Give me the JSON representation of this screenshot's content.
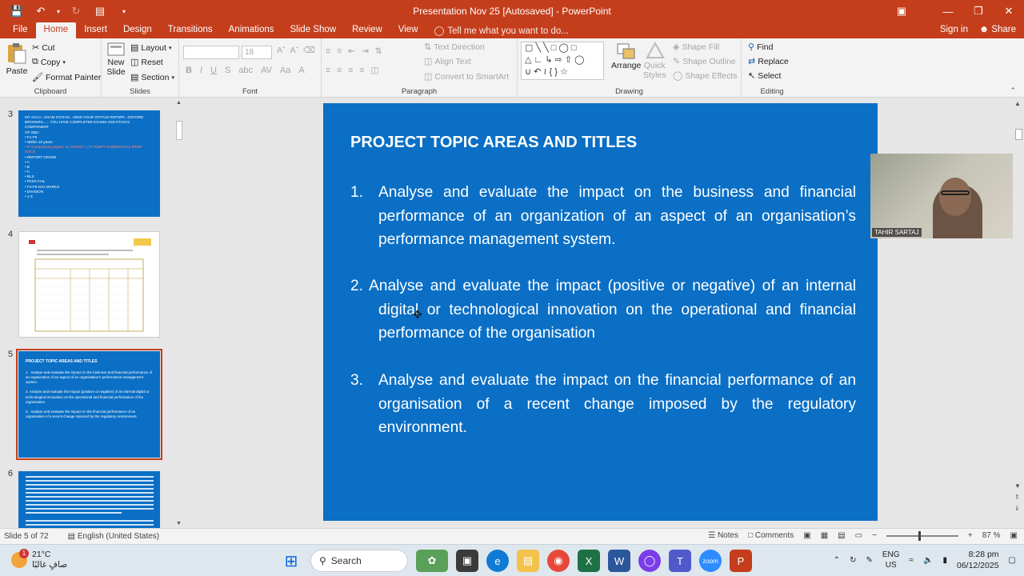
{
  "window": {
    "title": "Presentation Nov 25 [Autosaved] - PowerPoint"
  },
  "tabs": [
    "File",
    "Home",
    "Insert",
    "Design",
    "Transitions",
    "Animations",
    "Slide Show",
    "Review",
    "View"
  ],
  "tell_me": "Tell me what you want to do...",
  "account": {
    "signin": "Sign in",
    "share": "Share"
  },
  "ribbon": {
    "clipboard": {
      "label": "Clipboard",
      "paste": "Paste",
      "cut": "Cut",
      "copy": "Copy",
      "format_painter": "Format Painter"
    },
    "slides": {
      "label": "Slides",
      "new_slide": "New",
      "new_slide2": "Slide",
      "layout": "Layout",
      "reset": "Reset",
      "section": "Section"
    },
    "font": {
      "label": "Font",
      "size": "18"
    },
    "paragraph": {
      "label": "Paragraph",
      "text_direction": "Text Direction",
      "align_text": "Align Text",
      "convert": "Convert to SmartArt"
    },
    "drawing": {
      "label": "Drawing",
      "arrange": "Arrange",
      "quick_styles": "Quick",
      "quick_styles2": "Styles",
      "shape_fill": "Shape Fill",
      "shape_outline": "Shape Outline",
      "shape_effects": "Shape Effects"
    },
    "editing": {
      "label": "Editing",
      "find": "Find",
      "replace": "Replace",
      "select": "Select"
    }
  },
  "thumbnails": [
    {
      "num": "3",
      "lines": [
        "MY ACCA...EXAM STATUS...VIEW YOUR STATUS REPORT...OXFORD",
        "BROOKES...... YOU HAVE COMPLETED EXAMS AND ETHICS COMPONENT",
        "OF OBU",
        "• F1-F9",
        "   • Within 10 years",
        "• IF Compulsory papers, on GRANT 1 (ATTEMPT SUBMISSION) BRIEF DOCS",
        "• REPORT GRADE",
        "• A",
        "• B",
        "• C",
        "• BLS",
        "• PASS FAIL",
        "• F4-F9 AVG MARKS",
        "• DIVISION",
        "• 1-3"
      ]
    },
    {
      "num": "4"
    },
    {
      "num": "5",
      "title": "PROJECT TOPIC AREAS AND TITLES"
    },
    {
      "num": "6"
    }
  ],
  "slide": {
    "title": "PROJECT TOPIC AREAS AND TITLES",
    "items": [
      {
        "num": "1.",
        "text": "Analyse and evaluate the impact on the business and financial performance of an organization of an aspect of an organisation’s performance management system."
      },
      {
        "num": "2.",
        "text": "Analyse and evaluate the impact (positive or negative) of an internal digital or technological innovation on the operational and financial performance of the organisation"
      },
      {
        "num": "3.",
        "text": "Analyse and evaluate the impact on the financial performance of an organisation of a recent change imposed by the regulatory environment."
      }
    ]
  },
  "webcam": {
    "name": "TAHIR SARTAJ"
  },
  "status": {
    "slide": "Slide 5 of 72",
    "language": "English (United States)",
    "notes": "Notes",
    "comments": "Comments",
    "zoom": "87 %"
  },
  "taskbar": {
    "temp": "21°C",
    "weather": "صافٍ غالبًا",
    "search": "Search",
    "lang1": "ENG",
    "lang2": "US",
    "time": "8:28 pm",
    "date": "06/12/2025"
  },
  "colors": {
    "accent": "#c43e1c",
    "slide_bg": "#0a6fc5"
  }
}
